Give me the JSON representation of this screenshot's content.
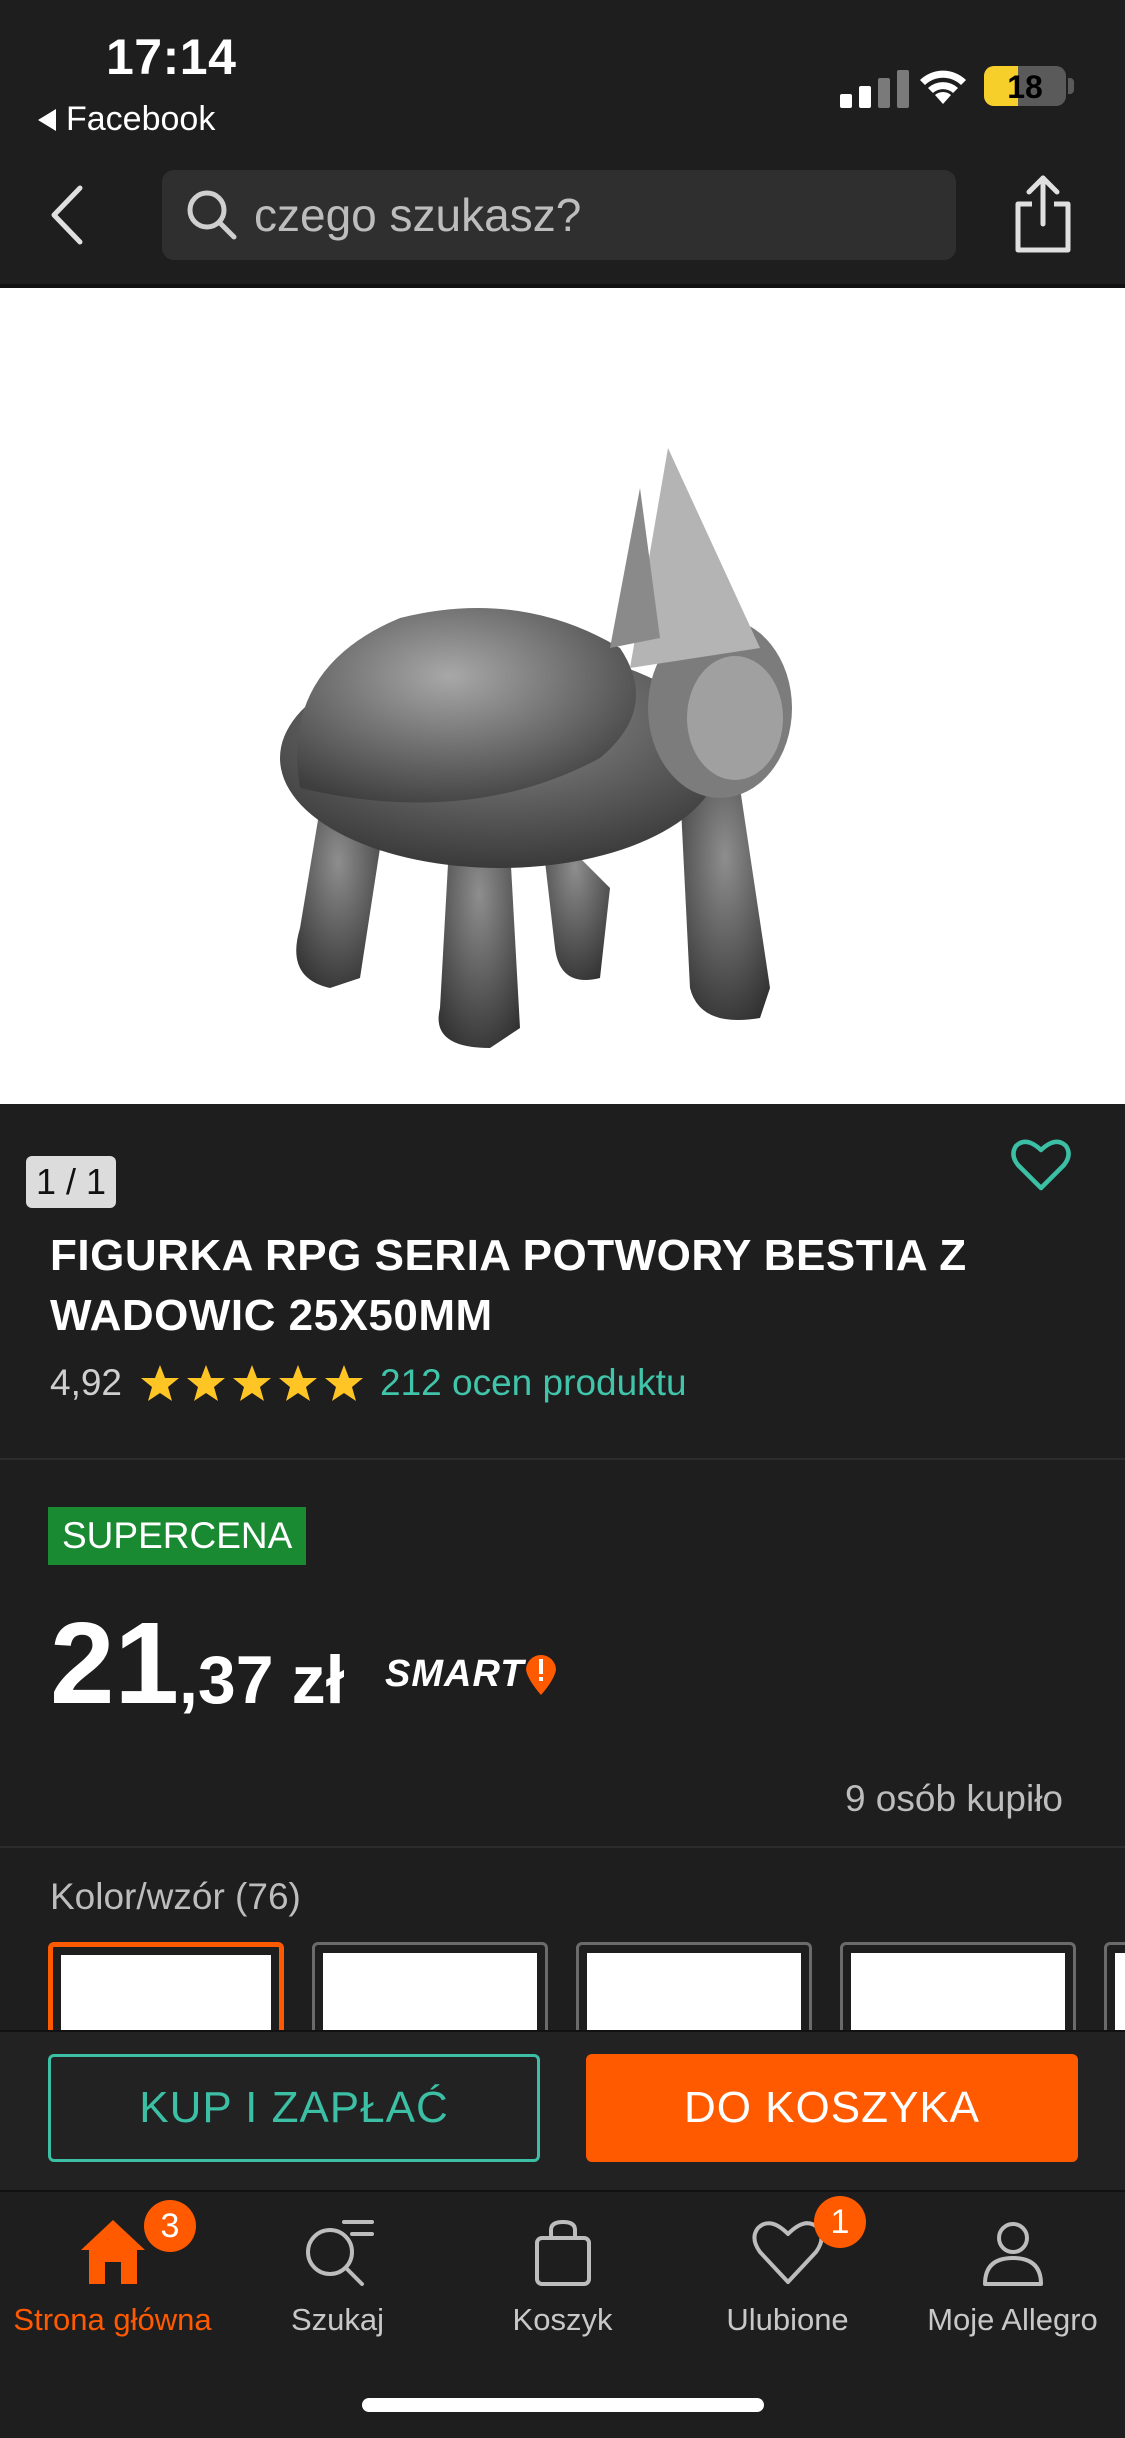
{
  "status_bar": {
    "time": "17:14",
    "back_app": "Facebook",
    "battery": "18"
  },
  "top_nav": {
    "search_placeholder": "czego szukasz?"
  },
  "gallery": {
    "counter": "1 / 1"
  },
  "product": {
    "title": "FIGURKA RPG SERIA POTWORY BESTIA Z WADOWIC 25X50MM",
    "rating": "4,92",
    "stars": 5,
    "reviews_link": "212 ocen produktu",
    "badge": "SUPERCENA",
    "price_int": "21",
    "price_dec": ",37",
    "currency": "zł",
    "smart_label": "SMART",
    "buyers": "9 osób kupiło"
  },
  "variants": {
    "label": "Kolor/wzór (76)"
  },
  "actions": {
    "buy_now": "KUP I ZAPŁAĆ",
    "add_to_cart": "DO KOSZYKA"
  },
  "tabbar": {
    "items": [
      {
        "label": "Strona główna",
        "icon": "home-icon",
        "badge": "3"
      },
      {
        "label": "Szukaj",
        "icon": "search-list-icon"
      },
      {
        "label": "Koszyk",
        "icon": "bag-icon"
      },
      {
        "label": "Ulubione",
        "icon": "heart-icon",
        "badge": "1"
      },
      {
        "label": "Moje Allegro",
        "icon": "user-icon"
      }
    ]
  },
  "colors": {
    "accent_orange": "#ff5a00",
    "accent_teal": "#3bbfa5",
    "badge_green": "#1a8a32",
    "background": "#1e1e1e"
  }
}
